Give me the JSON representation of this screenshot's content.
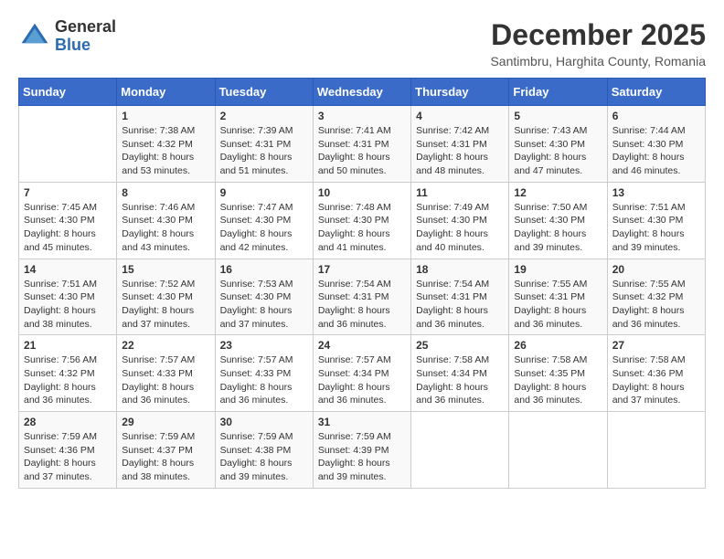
{
  "logo": {
    "general": "General",
    "blue": "Blue"
  },
  "title": "December 2025",
  "location": "Santimbru, Harghita County, Romania",
  "weekdays": [
    "Sunday",
    "Monday",
    "Tuesday",
    "Wednesday",
    "Thursday",
    "Friday",
    "Saturday"
  ],
  "weeks": [
    [
      {
        "day": "",
        "info": ""
      },
      {
        "day": "1",
        "info": "Sunrise: 7:38 AM\nSunset: 4:32 PM\nDaylight: 8 hours\nand 53 minutes."
      },
      {
        "day": "2",
        "info": "Sunrise: 7:39 AM\nSunset: 4:31 PM\nDaylight: 8 hours\nand 51 minutes."
      },
      {
        "day": "3",
        "info": "Sunrise: 7:41 AM\nSunset: 4:31 PM\nDaylight: 8 hours\nand 50 minutes."
      },
      {
        "day": "4",
        "info": "Sunrise: 7:42 AM\nSunset: 4:31 PM\nDaylight: 8 hours\nand 48 minutes."
      },
      {
        "day": "5",
        "info": "Sunrise: 7:43 AM\nSunset: 4:30 PM\nDaylight: 8 hours\nand 47 minutes."
      },
      {
        "day": "6",
        "info": "Sunrise: 7:44 AM\nSunset: 4:30 PM\nDaylight: 8 hours\nand 46 minutes."
      }
    ],
    [
      {
        "day": "7",
        "info": "Sunrise: 7:45 AM\nSunset: 4:30 PM\nDaylight: 8 hours\nand 45 minutes."
      },
      {
        "day": "8",
        "info": "Sunrise: 7:46 AM\nSunset: 4:30 PM\nDaylight: 8 hours\nand 43 minutes."
      },
      {
        "day": "9",
        "info": "Sunrise: 7:47 AM\nSunset: 4:30 PM\nDaylight: 8 hours\nand 42 minutes."
      },
      {
        "day": "10",
        "info": "Sunrise: 7:48 AM\nSunset: 4:30 PM\nDaylight: 8 hours\nand 41 minutes."
      },
      {
        "day": "11",
        "info": "Sunrise: 7:49 AM\nSunset: 4:30 PM\nDaylight: 8 hours\nand 40 minutes."
      },
      {
        "day": "12",
        "info": "Sunrise: 7:50 AM\nSunset: 4:30 PM\nDaylight: 8 hours\nand 39 minutes."
      },
      {
        "day": "13",
        "info": "Sunrise: 7:51 AM\nSunset: 4:30 PM\nDaylight: 8 hours\nand 39 minutes."
      }
    ],
    [
      {
        "day": "14",
        "info": "Sunrise: 7:51 AM\nSunset: 4:30 PM\nDaylight: 8 hours\nand 38 minutes."
      },
      {
        "day": "15",
        "info": "Sunrise: 7:52 AM\nSunset: 4:30 PM\nDaylight: 8 hours\nand 37 minutes."
      },
      {
        "day": "16",
        "info": "Sunrise: 7:53 AM\nSunset: 4:30 PM\nDaylight: 8 hours\nand 37 minutes."
      },
      {
        "day": "17",
        "info": "Sunrise: 7:54 AM\nSunset: 4:31 PM\nDaylight: 8 hours\nand 36 minutes."
      },
      {
        "day": "18",
        "info": "Sunrise: 7:54 AM\nSunset: 4:31 PM\nDaylight: 8 hours\nand 36 minutes."
      },
      {
        "day": "19",
        "info": "Sunrise: 7:55 AM\nSunset: 4:31 PM\nDaylight: 8 hours\nand 36 minutes."
      },
      {
        "day": "20",
        "info": "Sunrise: 7:55 AM\nSunset: 4:32 PM\nDaylight: 8 hours\nand 36 minutes."
      }
    ],
    [
      {
        "day": "21",
        "info": "Sunrise: 7:56 AM\nSunset: 4:32 PM\nDaylight: 8 hours\nand 36 minutes."
      },
      {
        "day": "22",
        "info": "Sunrise: 7:57 AM\nSunset: 4:33 PM\nDaylight: 8 hours\nand 36 minutes."
      },
      {
        "day": "23",
        "info": "Sunrise: 7:57 AM\nSunset: 4:33 PM\nDaylight: 8 hours\nand 36 minutes."
      },
      {
        "day": "24",
        "info": "Sunrise: 7:57 AM\nSunset: 4:34 PM\nDaylight: 8 hours\nand 36 minutes."
      },
      {
        "day": "25",
        "info": "Sunrise: 7:58 AM\nSunset: 4:34 PM\nDaylight: 8 hours\nand 36 minutes."
      },
      {
        "day": "26",
        "info": "Sunrise: 7:58 AM\nSunset: 4:35 PM\nDaylight: 8 hours\nand 36 minutes."
      },
      {
        "day": "27",
        "info": "Sunrise: 7:58 AM\nSunset: 4:36 PM\nDaylight: 8 hours\nand 37 minutes."
      }
    ],
    [
      {
        "day": "28",
        "info": "Sunrise: 7:59 AM\nSunset: 4:36 PM\nDaylight: 8 hours\nand 37 minutes."
      },
      {
        "day": "29",
        "info": "Sunrise: 7:59 AM\nSunset: 4:37 PM\nDaylight: 8 hours\nand 38 minutes."
      },
      {
        "day": "30",
        "info": "Sunrise: 7:59 AM\nSunset: 4:38 PM\nDaylight: 8 hours\nand 39 minutes."
      },
      {
        "day": "31",
        "info": "Sunrise: 7:59 AM\nSunset: 4:39 PM\nDaylight: 8 hours\nand 39 minutes."
      },
      {
        "day": "",
        "info": ""
      },
      {
        "day": "",
        "info": ""
      },
      {
        "day": "",
        "info": ""
      }
    ]
  ]
}
